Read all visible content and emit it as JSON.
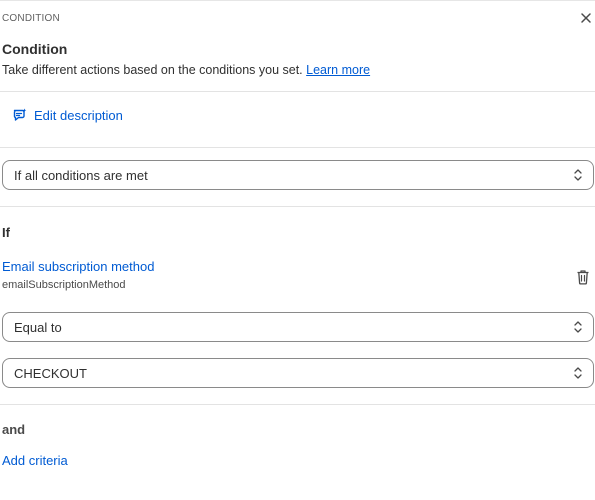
{
  "header": {
    "label": "CONDITION",
    "close_icon": "close-icon"
  },
  "condition": {
    "title": "Condition",
    "description": "Take different actions based on the conditions you set.",
    "learn_more": "Learn more"
  },
  "edit_description": {
    "icon": "edit-description-icon",
    "label": "Edit description"
  },
  "match_select": {
    "value": "If all conditions are met"
  },
  "if_section": {
    "label": "If",
    "field_name": "Email subscription method",
    "field_key": "emailSubscriptionMethod",
    "delete_icon": "trash-icon",
    "operator_select": {
      "value": "Equal to"
    },
    "value_select": {
      "value": "CHECKOUT"
    }
  },
  "and_section": {
    "label": "and",
    "add_criteria": "Add criteria"
  },
  "colors": {
    "link": "#005bd3",
    "text": "#303030",
    "border": "#8a8a8a",
    "divider": "#e3e3e3"
  }
}
